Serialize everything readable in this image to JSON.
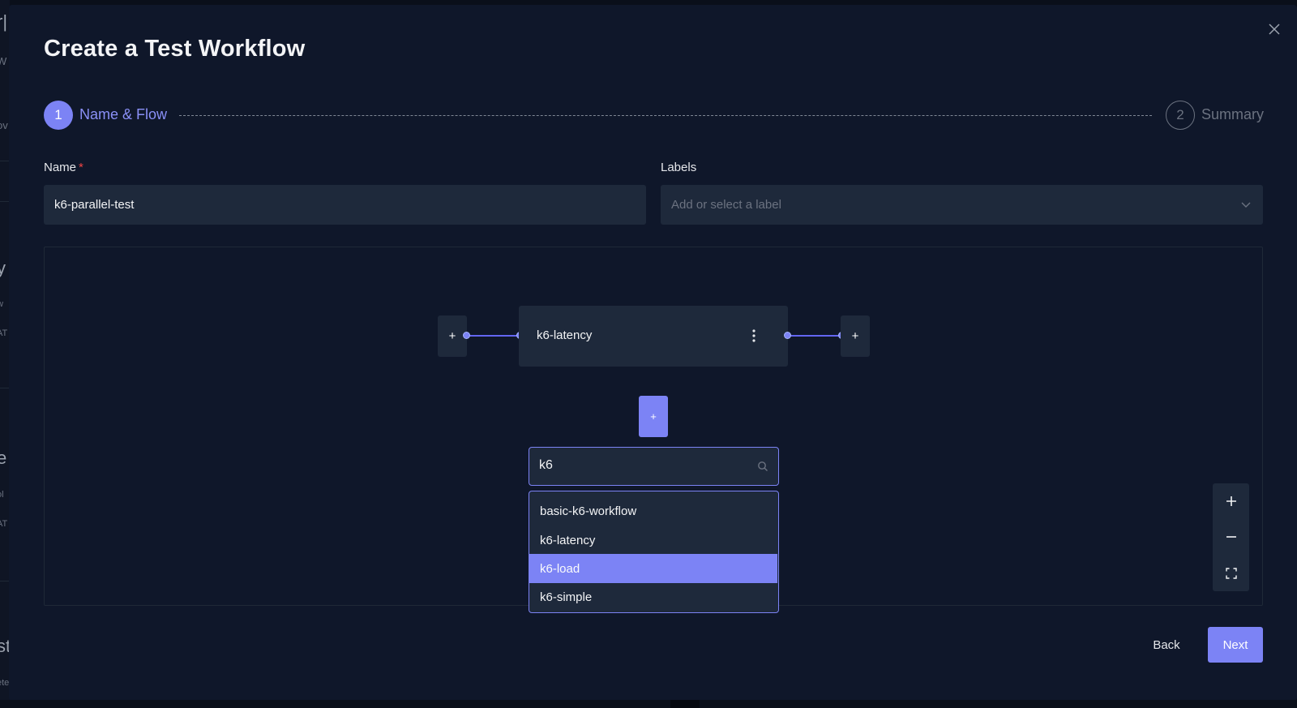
{
  "background": {
    "fragments": [
      "r|",
      "W",
      "ov",
      "y",
      "w",
      "AT",
      "e",
      "ol",
      "AT",
      "st",
      "ete"
    ]
  },
  "dialog": {
    "title": "Create a Test Workflow",
    "close_icon": "close-icon"
  },
  "stepper": {
    "steps": [
      {
        "number": "1",
        "label": "Name & Flow",
        "state": "active"
      },
      {
        "number": "2",
        "label": "Summary",
        "state": "inactive"
      }
    ]
  },
  "form": {
    "name_label": "Name",
    "name_required_mark": "*",
    "name_value": "k6-parallel-test",
    "labels_label": "Labels",
    "labels_placeholder": "Add or select a label"
  },
  "flow": {
    "left_add": "+",
    "right_add": "+",
    "below_add": "+",
    "node_label": "k6-latency",
    "search_value": "k6",
    "options": [
      "basic-k6-workflow",
      "k6-latency",
      "k6-load",
      "k6-simple"
    ],
    "highlighted_option": "k6-load"
  },
  "zoom_controls": {
    "icons": [
      "zoom-in-icon",
      "zoom-out-icon",
      "fit-view-icon"
    ]
  },
  "footer": {
    "back_label": "Back",
    "next_label": "Next"
  },
  "colors": {
    "accent": "#7c83f5",
    "surface": "#1e293b",
    "modal_bg": "#0f172a",
    "required": "#ef4444"
  }
}
